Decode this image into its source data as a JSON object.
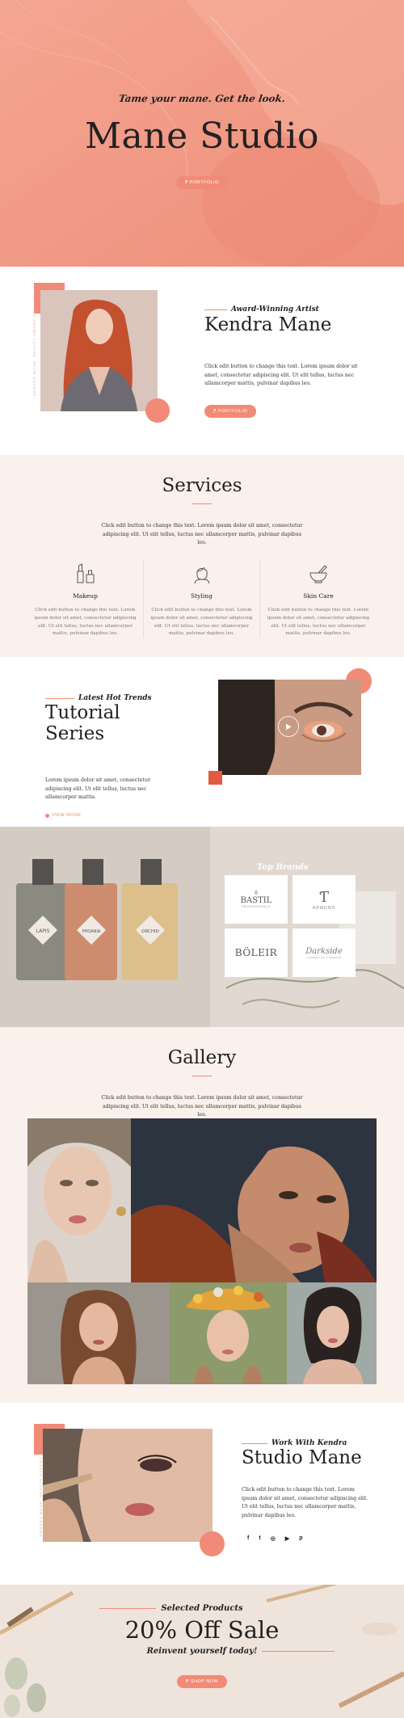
{
  "hero": {
    "tagline": "Tame your mane. Get the look.",
    "title": "Mane Studio",
    "button": "⁋ PORTFOLIO"
  },
  "about": {
    "subtitle": "Award-Winning Artist",
    "name": "Kendra Mane",
    "body": "Click edit button to change this text. Lorem ipsum dolor sit amet, consectetur adipiscing elit. Ut elit tellus, luctus nec ullamcorper mattis, pulvinar dapibus leo.",
    "button": "⁋ PORTFOLIO",
    "vertical": "KENDRA MANE, BEAUTY AWARD 2019"
  },
  "services": {
    "title": "Services",
    "intro": "Click edit button to change this text. Lorem ipsum dolor sit amet, consectetur adipiscing elit. Ut elit tellus, luctus nec ullamcorper mattis, pulvinar dapibus leo.",
    "items": [
      {
        "name": "Makeup",
        "icon": "makeup-icon",
        "text": "Click edit button to change this text. Lorem ipsum dolor sit amet, consectetur adipiscing elit. Ut elit tellus, luctus nec ullamcorper mattis, pulvinar dapibus leo."
      },
      {
        "name": "Styling",
        "icon": "styling-icon",
        "text": "Click edit button to change this text. Lorem ipsum dolor sit amet, consectetur adipiscing elit. Ut elit tellus, luctus nec ullamcorper mattis, pulvinar dapibus leo."
      },
      {
        "name": "Skin Care",
        "icon": "skin-care-icon",
        "text": "Click edit button to change this text. Lorem ipsum dolor sit amet, consectetur adipiscing elit. Ut elit tellus, luctus nec ullamcorper mattis, pulvinar dapibus leo."
      }
    ]
  },
  "tutorial": {
    "subtitle": "Latest Hot Trends",
    "title": "Tutorial Series",
    "body": "Lorem ipsum dolor sit amet, consectetur adipiscing elit. Ut elit tellus, luctus nec ullamcorper mattis.",
    "link": "VIEW MORE"
  },
  "brands": {
    "title": "Top Brands",
    "items": [
      {
        "name": "BASTIL",
        "sub": "PROFESSIONALS"
      },
      {
        "name": "ARMOND",
        "sub": ""
      },
      {
        "name": "BÖLEIR",
        "sub": ""
      },
      {
        "name": "Darkside",
        "sub": "COSMETICS & MAKEUP"
      }
    ],
    "bottle_labels": [
      "LAPIS",
      "PHOANIA",
      "ORCHID"
    ]
  },
  "gallery": {
    "title": "Gallery",
    "intro": "Click edit button to change this text. Lorem ipsum dolor sit amet, consectetur adipiscing elit. Ut elit tellus, luctus nec ullamcorper mattis, pulvinar dapibus leo."
  },
  "work": {
    "subtitle": "Work With Kendra",
    "title": "Studio Mane",
    "body": "Click edit button to change this text. Lorem ipsum dolor sit amet, consectetur adipiscing elit. Ut elit tellus, luctus nec ullamcorper mattis, pulvinar dapibus leo.",
    "vertical": "KENDRA MANE, BEAUTY EXPERT",
    "socials": [
      "f",
      "t",
      "◎",
      "▶",
      "p"
    ]
  },
  "sale": {
    "subtitle": "Selected Products",
    "title": "20% Off Sale",
    "tagline": "Reinvent yourself today!",
    "button": "⁋ SHOP NOW"
  },
  "colors": {
    "accent": "#f18a76",
    "hero_bg": "#f19a86",
    "soft_bg": "#faf1ec"
  }
}
